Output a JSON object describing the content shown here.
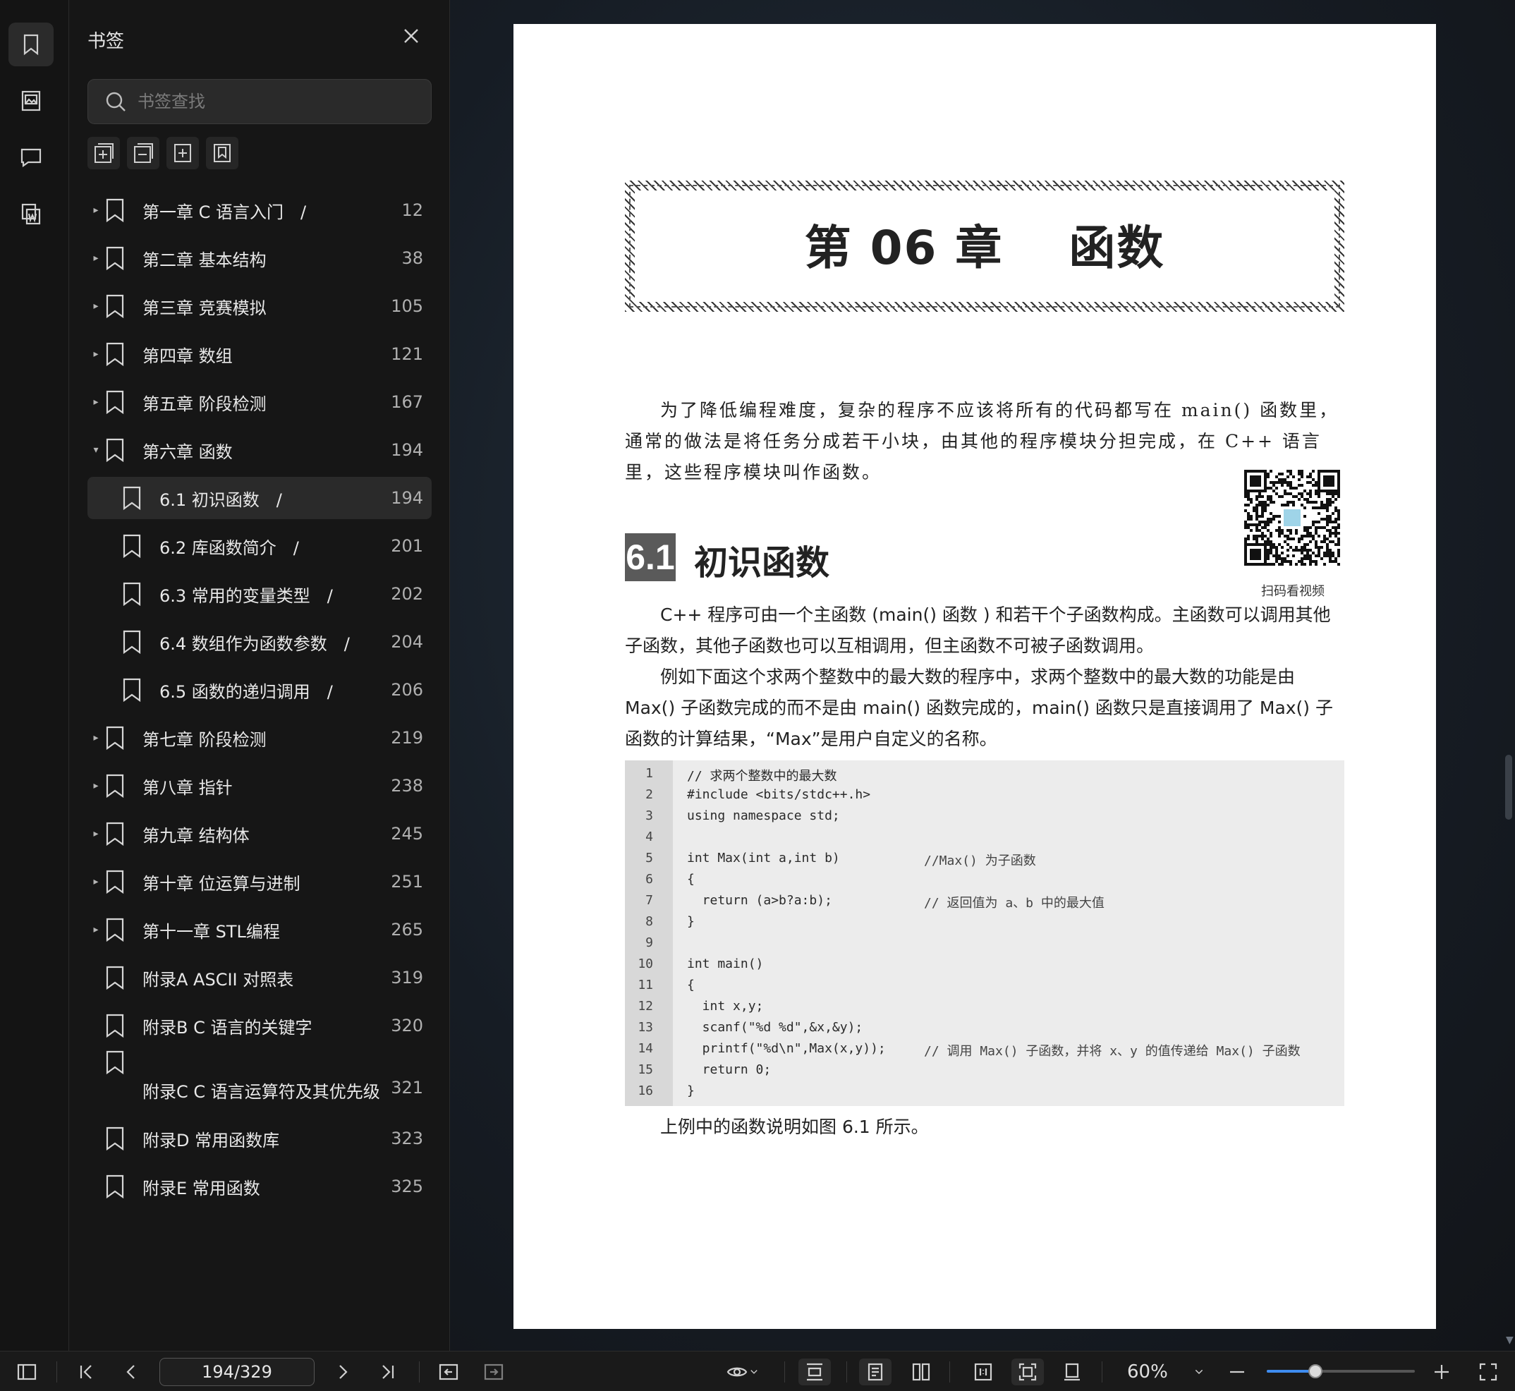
{
  "panel": {
    "title": "书签",
    "search_placeholder": "书签查找",
    "items": [
      {
        "label": "第一章 C 语言入门　/",
        "page": "12",
        "level": 0,
        "caret": "▸",
        "active": false
      },
      {
        "label": "第二章 基本结构",
        "page": "38",
        "level": 0,
        "caret": "▸",
        "active": false
      },
      {
        "label": "第三章 竞赛模拟",
        "page": "105",
        "level": 0,
        "caret": "▸",
        "active": false
      },
      {
        "label": "第四章 数组",
        "page": "121",
        "level": 0,
        "caret": "▸",
        "active": false
      },
      {
        "label": "第五章 阶段检测",
        "page": "167",
        "level": 0,
        "caret": "▸",
        "active": false
      },
      {
        "label": "第六章 函数",
        "page": "194",
        "level": 0,
        "caret": "▾",
        "active": false
      },
      {
        "label": "6.1 初识函数　/",
        "page": "194",
        "level": 1,
        "caret": "",
        "active": true
      },
      {
        "label": "6.2 库函数简介　/",
        "page": "201",
        "level": 1,
        "caret": "",
        "active": false
      },
      {
        "label": "6.3 常用的变量类型　/",
        "page": "202",
        "level": 1,
        "caret": "",
        "active": false
      },
      {
        "label": "6.4 数组作为函数参数　/",
        "page": "204",
        "level": 1,
        "caret": "",
        "active": false
      },
      {
        "label": "6.5 函数的递归调用　/",
        "page": "206",
        "level": 1,
        "caret": "",
        "active": false
      },
      {
        "label": "第七章 阶段检测",
        "page": "219",
        "level": 0,
        "caret": "▸",
        "active": false
      },
      {
        "label": "第八章 指针",
        "page": "238",
        "level": 0,
        "caret": "▸",
        "active": false
      },
      {
        "label": "第九章 结构体",
        "page": "245",
        "level": 0,
        "caret": "▸",
        "active": false
      },
      {
        "label": "第十章 位运算与进制",
        "page": "251",
        "level": 0,
        "caret": "▸",
        "active": false
      },
      {
        "label": "第十一章 STL编程",
        "page": "265",
        "level": 0,
        "caret": "▸",
        "active": false
      },
      {
        "label": "附录A ASCII 对照表",
        "page": "319",
        "level": 0,
        "caret": "",
        "active": false
      },
      {
        "label": "附录B C 语言的关键字",
        "page": "320",
        "level": 0,
        "caret": "",
        "active": false
      },
      {
        "label": "附录C C 语言运算符及其优先级",
        "page": "321",
        "level": 0,
        "caret": "",
        "active": false
      },
      {
        "label": "附录D 常用函数库",
        "page": "323",
        "level": 0,
        "caret": "",
        "active": false
      },
      {
        "label": "附录E 常用函数",
        "page": "325",
        "level": 0,
        "caret": "",
        "active": false
      }
    ]
  },
  "document": {
    "chapter_title": "第 06 章　 函数",
    "intro": "为了降低编程难度，复杂的程序不应该将所有的代码都写在 main() 函数里，通常的做法是将任务分成若干小块，由其他的程序模块分担完成，在 C++ 语言里，这些程序模块叫作函数。",
    "section_number": "6.1",
    "section_title": "初识函数",
    "qr_label": "扫码看视频",
    "para1": "C++ 程序可由一个主函数 (main() 函数 ) 和若干个子函数构成。主函数可以调用其他子函数，其他子函数也可以互相调用，但主函数不可被子函数调用。",
    "para2": "例如下面这个求两个整数中的最大数的程序中，求两个整数中的最大数的功能是由 Max() 子函数完成的而不是由 main() 函数完成的，main() 函数只是直接调用了 Max() 子函数的计算结果，“Max”是用户自定义的名称。",
    "code": [
      {
        "n": "1",
        "src": "// 求两个整数中的最大数",
        "cm": ""
      },
      {
        "n": "2",
        "src": "#include <bits/stdc++.h>",
        "cm": ""
      },
      {
        "n": "3",
        "src": "using namespace std;",
        "cm": ""
      },
      {
        "n": "4",
        "src": "",
        "cm": ""
      },
      {
        "n": "5",
        "src": "int Max(int a,int b)",
        "cm": "//Max() 为子函数"
      },
      {
        "n": "6",
        "src": "{",
        "cm": ""
      },
      {
        "n": "7",
        "src": "  return (a>b?a:b);",
        "cm": "// 返回值为 a、b 中的最大值"
      },
      {
        "n": "8",
        "src": "}",
        "cm": ""
      },
      {
        "n": "9",
        "src": "",
        "cm": ""
      },
      {
        "n": "10",
        "src": "int main()",
        "cm": ""
      },
      {
        "n": "11",
        "src": "{",
        "cm": ""
      },
      {
        "n": "12",
        "src": "  int x,y;",
        "cm": ""
      },
      {
        "n": "13",
        "src": "  scanf(\"%d %d\",&x,&y);",
        "cm": ""
      },
      {
        "n": "14",
        "src": "  printf(\"%d\\n\",Max(x,y));",
        "cm": "// 调用 Max() 子函数，并将 x、y 的值传递给 Max() 子函数"
      },
      {
        "n": "15",
        "src": "  return 0;",
        "cm": ""
      },
      {
        "n": "16",
        "src": "}",
        "cm": ""
      }
    ],
    "after_code": "上例中的函数说明如图 6.1 所示。"
  },
  "toolbar": {
    "page_indicator": "194/329",
    "zoom": "60%",
    "zoom_fraction": 0.33
  }
}
